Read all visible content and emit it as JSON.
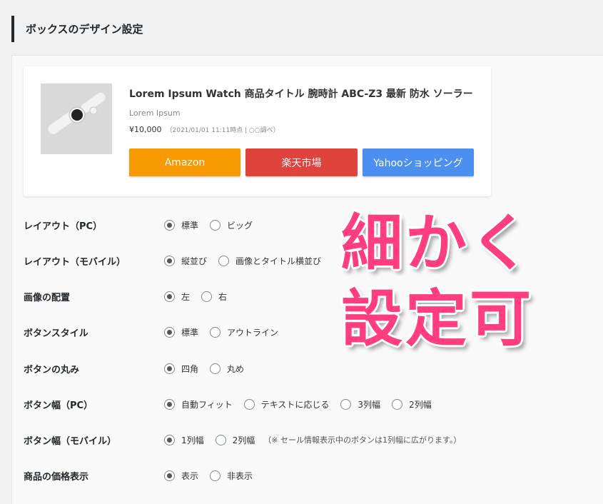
{
  "header": {
    "title": "ボックスのデザイン設定"
  },
  "preview": {
    "title": "Lorem Ipsum Watch 商品タイトル 腕時計 ABC-Z3 最新 防水 ソーラー",
    "brand": "Lorem Ipsum",
    "price": "¥10,000",
    "price_note": "（2021/01/01 11:11時点 | ○○調べ）",
    "buttons": [
      {
        "label": "Amazon",
        "color": "#f79901"
      },
      {
        "label": "楽天市場",
        "color": "#e0423c"
      },
      {
        "label": "Yahooショッピング",
        "color": "#4b8ff0"
      }
    ]
  },
  "settings": [
    {
      "label": "レイアウト（PC）",
      "options": [
        "標準",
        "ビッグ"
      ],
      "selected": 0
    },
    {
      "label": "レイアウト（モバイル）",
      "options": [
        "縦並び",
        "画像とタイトル横並び"
      ],
      "selected": 0
    },
    {
      "label": "画像の配置",
      "options": [
        "左",
        "右"
      ],
      "selected": 0
    },
    {
      "label": "ボタンスタイル",
      "options": [
        "標準",
        "アウトライン"
      ],
      "selected": 0
    },
    {
      "label": "ボタンの丸み",
      "options": [
        "四角",
        "丸め"
      ],
      "selected": 0
    },
    {
      "label": "ボタン幅（PC）",
      "options": [
        "自動フィット",
        "テキストに応じる",
        "3列幅",
        "2列幅"
      ],
      "selected": 0
    },
    {
      "label": "ボタン幅（モバイル）",
      "options": [
        "1列幅",
        "2列幅"
      ],
      "selected": 0,
      "note": "（※ セール情報表示中のボタンは1列幅に広がります。）"
    },
    {
      "label": "商品の価格表示",
      "options": [
        "表示",
        "非表示"
      ],
      "selected": 0
    }
  ],
  "overlay": {
    "line1": "細かく",
    "line2": "設定可",
    "color": "#ff3d7f"
  },
  "colors": {
    "accent_bar": "#23282d",
    "panel_bg": "#f9f9f9",
    "page_bg": "#f1f1f1"
  }
}
